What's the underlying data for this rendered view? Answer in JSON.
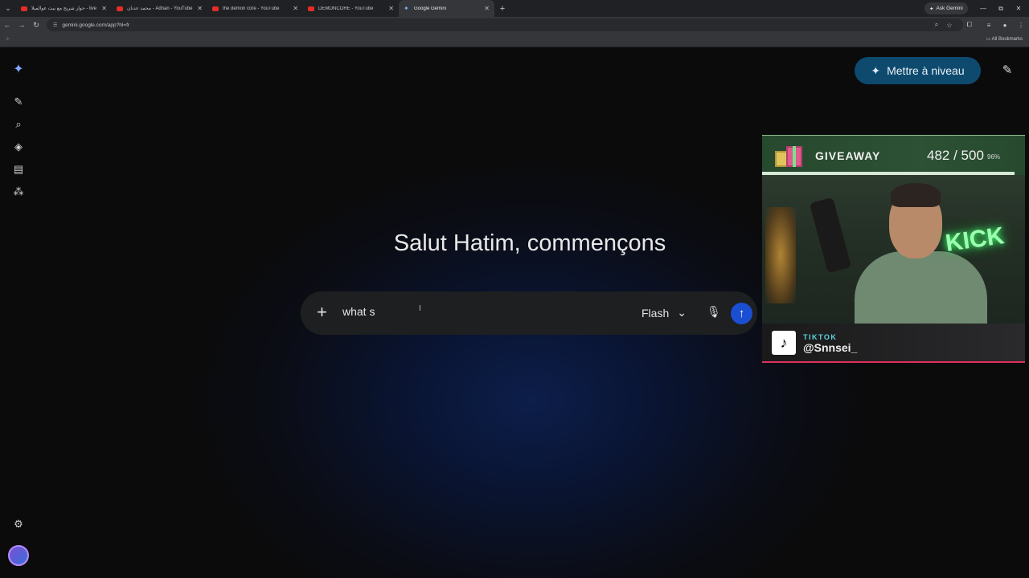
{
  "browser": {
    "tabs": [
      {
        "title": "حوار شريح مع بيت عوالميلا - live",
        "icon": "youtube-icon"
      },
      {
        "title": "محمد عدنان - Adnan - YouTube",
        "icon": "youtube-icon"
      },
      {
        "title": "the demon core - YouTube",
        "icon": "youtube-icon"
      },
      {
        "title": "DEMONCORE - YouTube",
        "icon": "youtube-icon"
      },
      {
        "title": "Google Gemini",
        "icon": "gemini-icon",
        "active": true
      }
    ],
    "ask_gemini_label": "Ask Gemini",
    "url": "gemini.google.com/app?hl=fr",
    "all_bookmarks_label": "All Bookmarks"
  },
  "gemini": {
    "upgrade_label": "Mettre à niveau",
    "greeting": "Salut Hatim, commençons",
    "prompt": {
      "value": "what s",
      "model": "Flash"
    },
    "rail_icons": [
      "new-chat-icon",
      "search-icon",
      "gems-icon",
      "library-icon",
      "apps-icon"
    ],
    "accent_color": "#1a4fd1",
    "upgrade_color": "#0e4a6e"
  },
  "overlay": {
    "giveaway_label": "GIVEAWAY",
    "giveaway_count": "482 / 500",
    "giveaway_percent": "96%",
    "giveaway_progress": 0.96,
    "webcam_sign": "KICK",
    "platform": "TIKTOK",
    "handle": "@Snnsei_"
  }
}
